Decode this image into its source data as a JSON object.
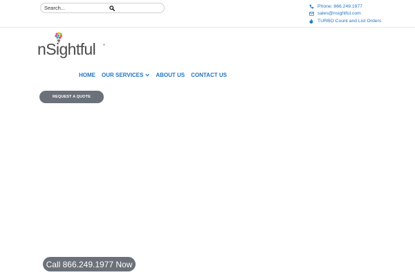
{
  "search": {
    "placeholder": "Search...",
    "button_icon": "search-icon"
  },
  "contact": {
    "phone": "Phone: 866.249.1977",
    "email": "sales@nsightful.com",
    "turbo": "TURBO Count and List Orders",
    "icon_color": "#2277c2"
  },
  "logo": {
    "text": "nSightful",
    "reg": "®"
  },
  "nav": {
    "items": [
      {
        "label": "HOME"
      },
      {
        "label": "OUR SERVICES"
      },
      {
        "label": "ABOUT US"
      },
      {
        "label": "CONTACT US"
      }
    ]
  },
  "cta": {
    "quote_label": "REQUEST A QUOTE",
    "call_label": "Call 866.249.1977 Now",
    "button_color": "#6b7178"
  },
  "colors": {
    "accent": "#2277c2",
    "text": "#4a4a4a"
  }
}
